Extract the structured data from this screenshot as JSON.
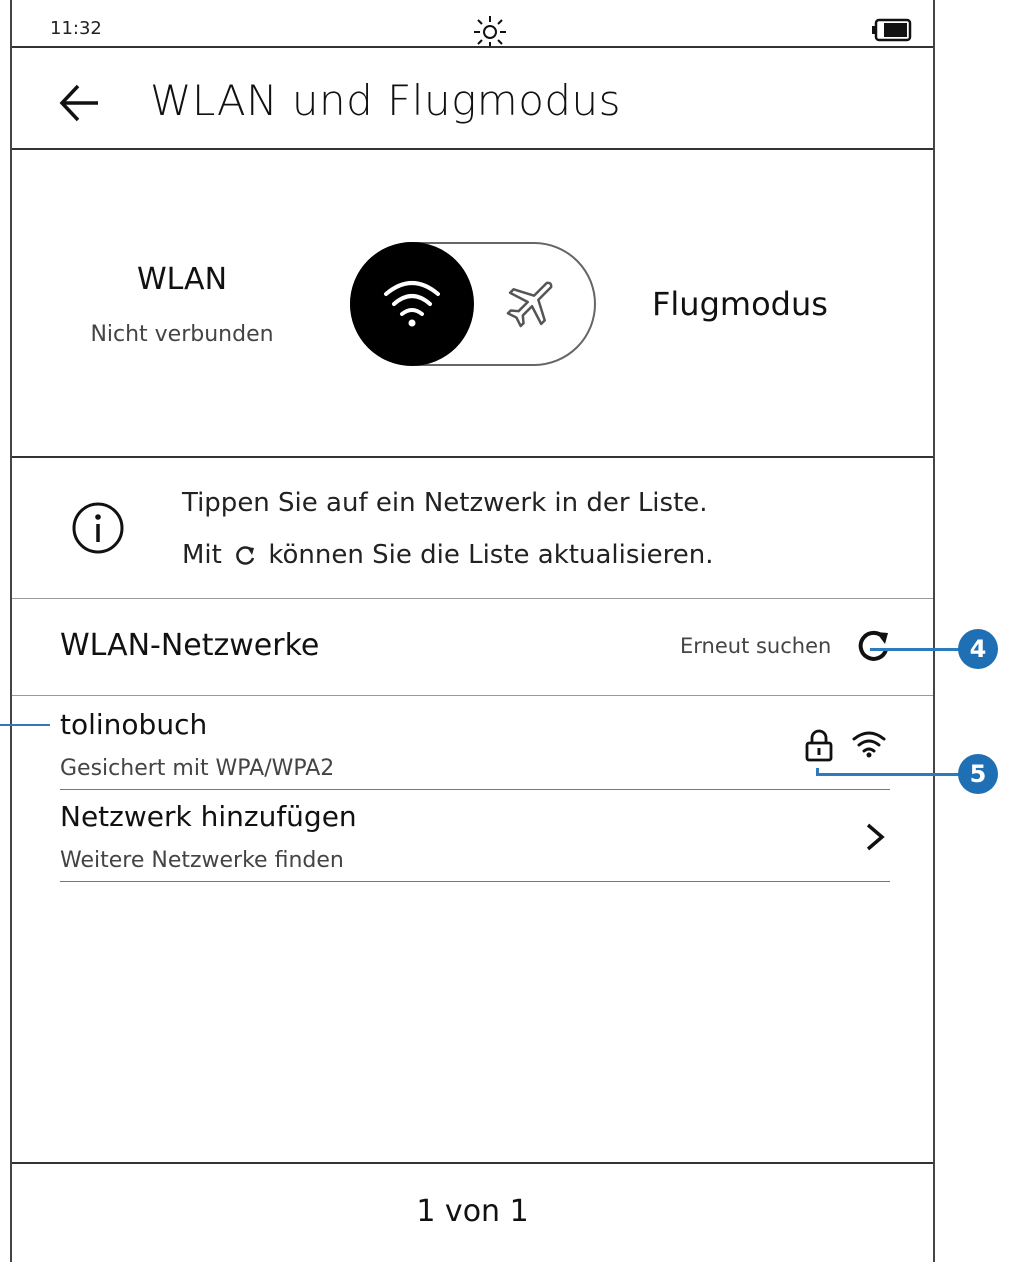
{
  "status_bar": {
    "time": "11:32"
  },
  "header": {
    "title": "WLAN und Flugmodus"
  },
  "toggle": {
    "left_label": "WLAN",
    "left_status": "Nicht verbunden",
    "right_label": "Flugmodus",
    "state": "wlan"
  },
  "info": {
    "line1": "Tippen Sie auf ein Netzwerk in der Liste.",
    "line2_prefix": "Mit",
    "line2_suffix": "können Sie die Liste aktualisieren."
  },
  "networks": {
    "title": "WLAN-Netzwerke",
    "rescan_label": "Erneut suchen",
    "items": [
      {
        "name": "tolinobuch",
        "security": "Gesichert mit WPA/WPA2"
      }
    ],
    "add": {
      "label": "Netzwerk hinzufügen",
      "sub": "Weitere Netzwerke finden"
    }
  },
  "pager": {
    "text": "1 von 1"
  },
  "callouts": [
    "4",
    "5"
  ],
  "colors": {
    "callout": "#1f6fb4"
  }
}
